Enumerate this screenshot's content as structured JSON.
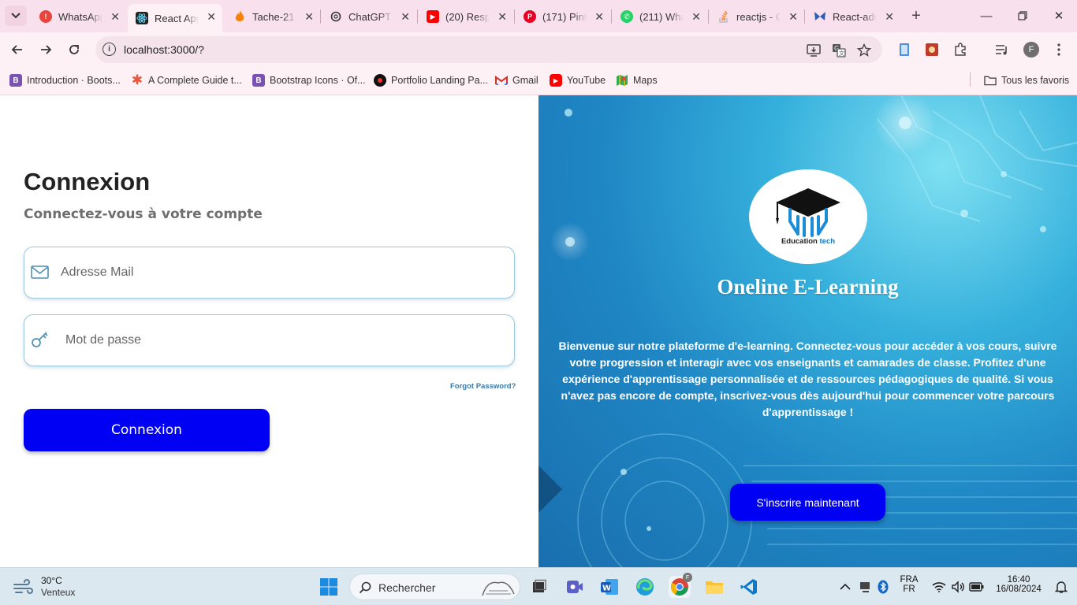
{
  "browser": {
    "tabs": [
      {
        "label": "WhatsApp",
        "favicon": "whatsapp-alert-icon",
        "color": "#e8453c"
      },
      {
        "label": "React App",
        "favicon": "react-icon",
        "color": "#222222",
        "active": true
      },
      {
        "label": "Tache-21",
        "favicon": "fire-icon",
        "color": "#f5820b"
      },
      {
        "label": "ChatGPT",
        "favicon": "chatgpt-icon",
        "color": "#333333"
      },
      {
        "label": "(20) Resp",
        "favicon": "youtube-icon",
        "color": "#ff0000"
      },
      {
        "label": "(171) Pint",
        "favicon": "pinterest-icon",
        "color": "#e60023"
      },
      {
        "label": "(211) Wha",
        "favicon": "whatsapp-icon",
        "color": "#25d366"
      },
      {
        "label": "reactjs - C",
        "favicon": "stackoverflow-icon",
        "color": "#f48024"
      },
      {
        "label": "React-adr",
        "favicon": "butterfly-icon",
        "color": "#2d5fb5"
      }
    ],
    "address": {
      "url": "localhost:3000/?"
    },
    "bookmarks": [
      {
        "label": "Introduction · Boots...",
        "icon": "bootstrap-icon",
        "color": "#7952b3"
      },
      {
        "label": "A Complete Guide t...",
        "icon": "asterisk-icon",
        "color": "#e8553a"
      },
      {
        "label": "Bootstrap Icons · Of...",
        "icon": "bootstrap-icon",
        "color": "#7952b3"
      },
      {
        "label": "Portfolio Landing Pa...",
        "icon": "portfolio-icon",
        "color": "#111111"
      },
      {
        "label": "Gmail",
        "icon": "gmail-icon",
        "color": "#d93025"
      },
      {
        "label": "YouTube",
        "icon": "youtube-icon",
        "color": "#ff0000"
      },
      {
        "label": "Maps",
        "icon": "maps-icon",
        "color": "#34a853"
      }
    ],
    "all_bookmarks": "Tous les favoris",
    "profile_initial": "F"
  },
  "login": {
    "title": "Connexion",
    "subtitle": "Connectez-vous à votre compte",
    "email_placeholder": "Adresse Mail",
    "password_placeholder": "Mot de passe",
    "forgot": "Forgot Password?",
    "submit": "Connexion"
  },
  "hero": {
    "logo_text_1": "Education",
    "logo_text_2": "tech",
    "brand": "Oneline E-Learning",
    "welcome": "Bienvenue sur notre plateforme d'e-learning. Connectez-vous pour accéder à vos cours, suivre votre progression et interagir avec vos enseignants et camarades de classe. Profitez d'une expérience d'apprentissage personnalisée et de ressources pédagogiques de qualité. Si vous n'avez pas encore de compte, inscrivez-vous dès aujourd'hui pour commencer votre parcours d'apprentissage !",
    "signup": "S'inscrire maintenant"
  },
  "taskbar": {
    "temperature": "30°C",
    "weather": "Venteux",
    "search": "Rechercher",
    "lang1": "FRA",
    "lang2": "FR",
    "time": "16:40",
    "date": "16/08/2024"
  },
  "colors": {
    "accent_button": "#0000f5",
    "hero_bg": "#1f86c4"
  }
}
